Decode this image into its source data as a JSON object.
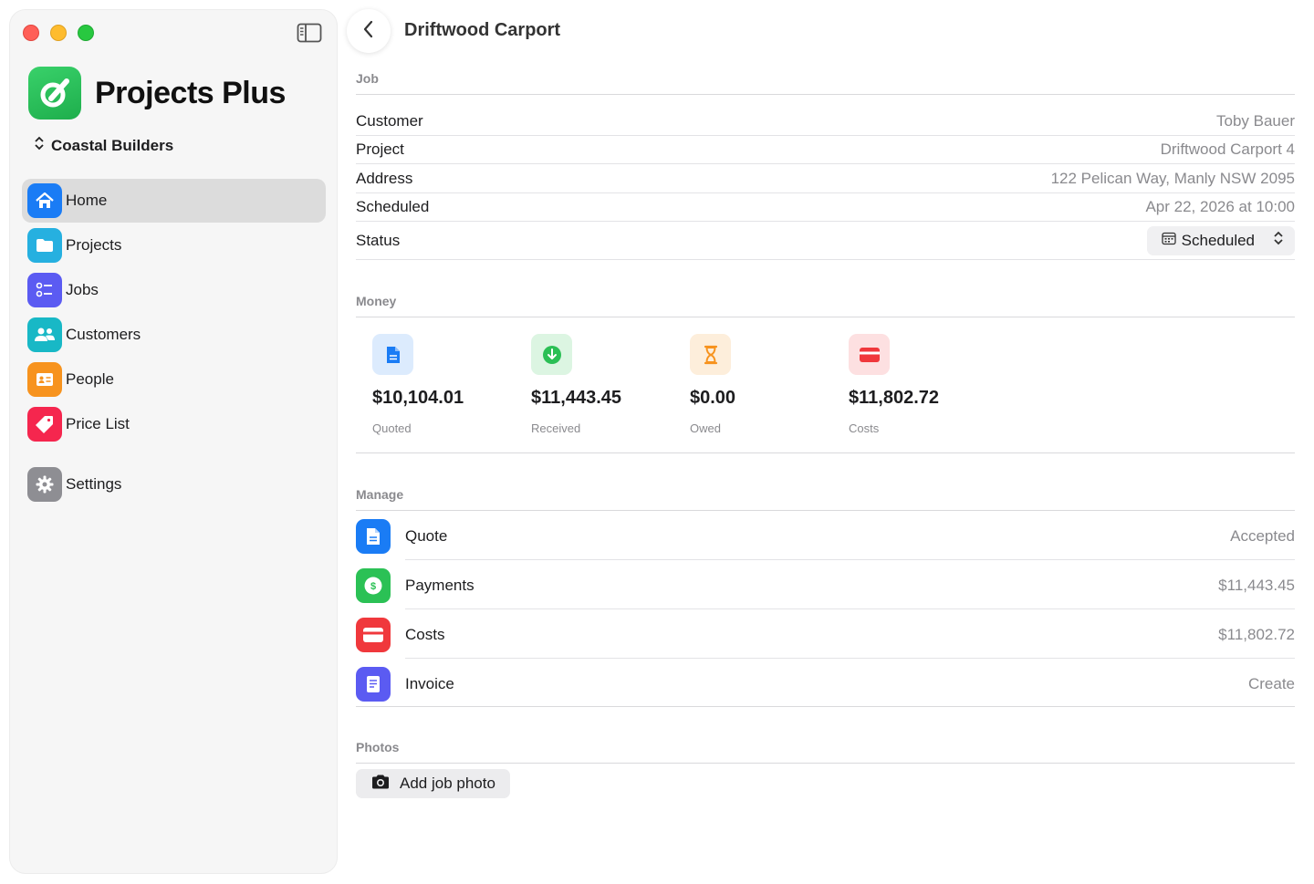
{
  "sidebar": {
    "app_name": "Projects Plus",
    "organization": "Coastal Builders",
    "items": [
      {
        "label": "Home",
        "icon": "house-icon",
        "color": "#1a7cf5"
      },
      {
        "label": "Projects",
        "icon": "folder-icon",
        "color": "#26b0e0"
      },
      {
        "label": "Jobs",
        "icon": "checklist-icon",
        "color": "#5b5bf2"
      },
      {
        "label": "Customers",
        "icon": "people-icon",
        "color": "#18b8c6"
      },
      {
        "label": "People",
        "icon": "id-card-icon",
        "color": "#f7931e"
      },
      {
        "label": "Price List",
        "icon": "tag-icon",
        "color": "#f5264e"
      },
      {
        "label": "Settings",
        "icon": "gear-icon",
        "color": "#8e8e93"
      }
    ]
  },
  "header": {
    "title": "Driftwood Carport"
  },
  "job": {
    "section_label": "Job",
    "rows": [
      {
        "key": "Customer",
        "value": "Toby Bauer"
      },
      {
        "key": "Project",
        "value": "Driftwood Carport 4"
      },
      {
        "key": "Address",
        "value": "122 Pelican Way, Manly NSW 2095"
      },
      {
        "key": "Scheduled",
        "value": "Apr 22, 2026 at 10:00"
      }
    ],
    "status_label": "Status",
    "status_value": "Scheduled"
  },
  "money": {
    "section_label": "Money",
    "cards": [
      {
        "amount": "$10,104.01",
        "label": "Quoted",
        "icon": "document-icon",
        "color": "#1a7cf5",
        "bg": "#dcebfd"
      },
      {
        "amount": "$11,443.45",
        "label": "Received",
        "icon": "arrow-down-circle-icon",
        "color": "#2bbf55",
        "bg": "#dcf5e2"
      },
      {
        "amount": "$0.00",
        "label": "Owed",
        "icon": "hourglass-icon",
        "color": "#f7931e",
        "bg": "#fdeedb"
      },
      {
        "amount": "$11,802.72",
        "label": "Costs",
        "icon": "credit-card-icon",
        "color": "#f0383c",
        "bg": "#fde0e1"
      }
    ]
  },
  "manage": {
    "section_label": "Manage",
    "rows": [
      {
        "label": "Quote",
        "value": "Accepted",
        "icon": "document-icon",
        "color": "#1a7cf5"
      },
      {
        "label": "Payments",
        "value": "$11,443.45",
        "icon": "dollar-circle-icon",
        "color": "#2bc155"
      },
      {
        "label": "Costs",
        "value": "$11,802.72",
        "icon": "credit-card-icon",
        "color": "#f0383c"
      },
      {
        "label": "Invoice",
        "value": "Create",
        "icon": "invoice-icon",
        "color": "#5b5bf2"
      }
    ]
  },
  "photos": {
    "section_label": "Photos",
    "add_label": "Add job photo"
  }
}
